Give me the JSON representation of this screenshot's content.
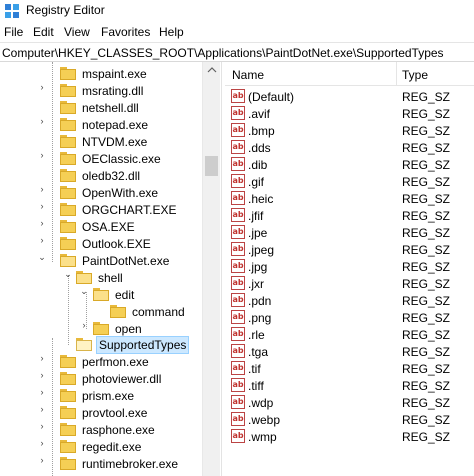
{
  "window": {
    "title": "Registry Editor"
  },
  "menu": {
    "items": [
      "File",
      "Edit",
      "View",
      "Favorites",
      "Help"
    ]
  },
  "address": {
    "path": "Computer\\HKEY_CLASSES_ROOT\\Applications\\PaintDotNet.exe\\SupportedTypes"
  },
  "tree": {
    "items": [
      {
        "label": "mspaint.exe"
      },
      {
        "label": "msrating.dll"
      },
      {
        "label": "netshell.dll"
      },
      {
        "label": "notepad.exe"
      },
      {
        "label": "NTVDM.exe"
      },
      {
        "label": "OEClassic.exe"
      },
      {
        "label": "oledb32.dll"
      },
      {
        "label": "OpenWith.exe"
      },
      {
        "label": "ORGCHART.EXE"
      },
      {
        "label": "OSA.EXE"
      },
      {
        "label": "Outlook.EXE"
      },
      {
        "label": "PaintDotNet.exe"
      },
      {
        "label": "shell"
      },
      {
        "label": "edit"
      },
      {
        "label": "command"
      },
      {
        "label": "open"
      },
      {
        "label": "SupportedTypes"
      },
      {
        "label": "perfmon.exe"
      },
      {
        "label": "photoviewer.dll"
      },
      {
        "label": "prism.exe"
      },
      {
        "label": "provtool.exe"
      },
      {
        "label": "rasphone.exe"
      },
      {
        "label": "regedit.exe"
      },
      {
        "label": "runtimebroker.exe"
      }
    ]
  },
  "list": {
    "header_name": "Name",
    "header_type": "Type",
    "rows": [
      {
        "name": "(Default)",
        "type": "REG_SZ"
      },
      {
        "name": ".avif",
        "type": "REG_SZ"
      },
      {
        "name": ".bmp",
        "type": "REG_SZ"
      },
      {
        "name": ".dds",
        "type": "REG_SZ"
      },
      {
        "name": ".dib",
        "type": "REG_SZ"
      },
      {
        "name": ".gif",
        "type": "REG_SZ"
      },
      {
        "name": ".heic",
        "type": "REG_SZ"
      },
      {
        "name": ".jfif",
        "type": "REG_SZ"
      },
      {
        "name": ".jpe",
        "type": "REG_SZ"
      },
      {
        "name": ".jpeg",
        "type": "REG_SZ"
      },
      {
        "name": ".jpg",
        "type": "REG_SZ"
      },
      {
        "name": ".jxr",
        "type": "REG_SZ"
      },
      {
        "name": ".pdn",
        "type": "REG_SZ"
      },
      {
        "name": ".png",
        "type": "REG_SZ"
      },
      {
        "name": ".rle",
        "type": "REG_SZ"
      },
      {
        "name": ".tga",
        "type": "REG_SZ"
      },
      {
        "name": ".tif",
        "type": "REG_SZ"
      },
      {
        "name": ".tiff",
        "type": "REG_SZ"
      },
      {
        "name": ".wdp",
        "type": "REG_SZ"
      },
      {
        "name": ".webp",
        "type": "REG_SZ"
      },
      {
        "name": ".wmp",
        "type": "REG_SZ"
      }
    ]
  },
  "icons": {
    "app": "registry-icon",
    "folder": "folder-icon",
    "string_value": "string-value-icon",
    "string_value_glyph": "ab"
  },
  "colors": {
    "selection": "#cce8ff",
    "folder": "#f5cf55"
  }
}
